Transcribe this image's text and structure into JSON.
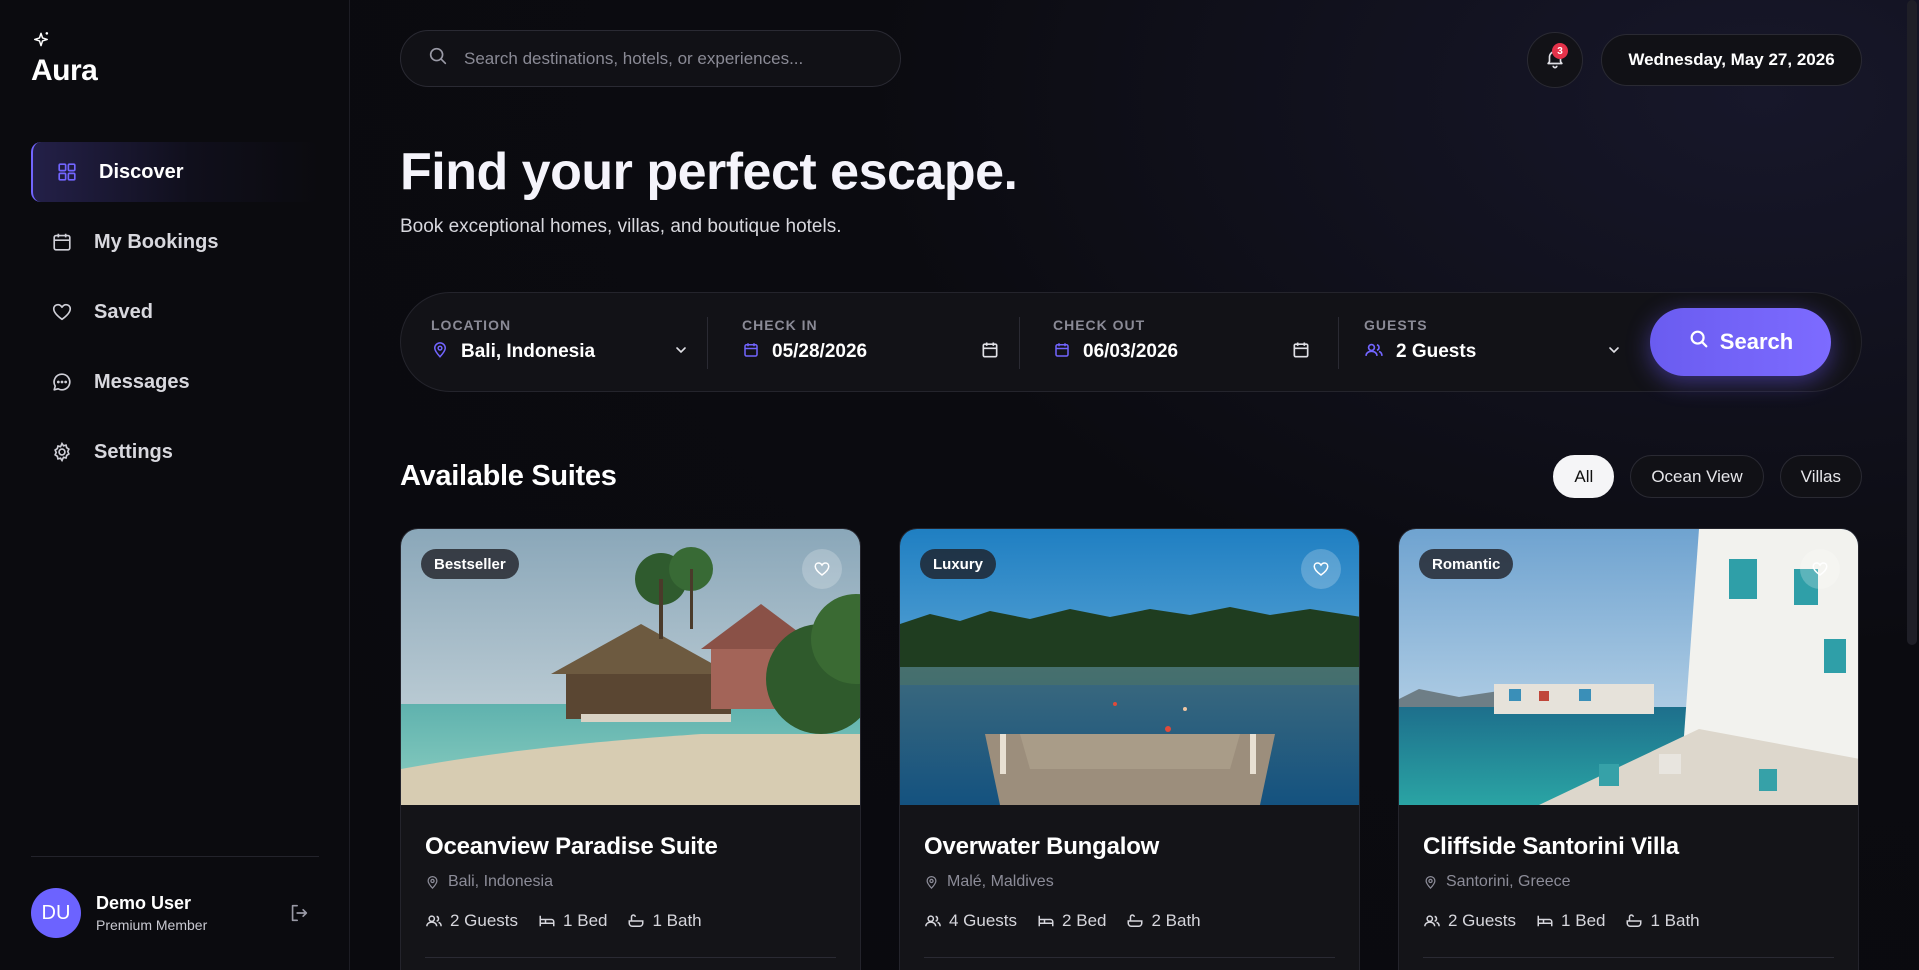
{
  "brand": {
    "name": "Aura",
    "icon": "sparkle-icon"
  },
  "sidebar": {
    "items": [
      {
        "label": "Discover",
        "icon": "grid-icon",
        "active": true
      },
      {
        "label": "My Bookings",
        "icon": "calendar-icon",
        "active": false
      },
      {
        "label": "Saved",
        "icon": "heart-icon",
        "active": false
      },
      {
        "label": "Messages",
        "icon": "chat-icon",
        "active": false
      },
      {
        "label": "Settings",
        "icon": "gear-icon",
        "active": false
      }
    ],
    "user": {
      "initials": "DU",
      "name": "Demo User",
      "plan": "Premium Member"
    }
  },
  "header": {
    "search_placeholder": "Search destinations, hotels, or experiences...",
    "notification_count": "3",
    "date": "Wednesday, May 27, 2026"
  },
  "hero": {
    "title": "Find your perfect escape.",
    "subtitle": "Book exceptional homes, villas, and boutique hotels."
  },
  "booking": {
    "location": {
      "label": "LOCATION",
      "value": "Bali, Indonesia"
    },
    "check_in": {
      "label": "CHECK IN",
      "value": "05/28/2026"
    },
    "check_out": {
      "label": "CHECK OUT",
      "value": "06/03/2026"
    },
    "guests": {
      "label": "GUESTS",
      "value": "2 Guests"
    },
    "search_label": "Search"
  },
  "suites": {
    "title": "Available Suites",
    "filters": [
      {
        "label": "All",
        "active": true
      },
      {
        "label": "Ocean View",
        "active": false
      },
      {
        "label": "Villas",
        "active": false
      }
    ],
    "cards": [
      {
        "tag": "Bestseller",
        "title": "Oceanview Paradise Suite",
        "location": "Bali, Indonesia",
        "guests": "2 Guests",
        "beds": "1 Bed",
        "baths": "1 Bath"
      },
      {
        "tag": "Luxury",
        "title": "Overwater Bungalow",
        "location": "Malé, Maldives",
        "guests": "4 Guests",
        "beds": "2 Bed",
        "baths": "2 Bath"
      },
      {
        "tag": "Romantic",
        "title": "Cliffside Santorini Villa",
        "location": "Santorini, Greece",
        "guests": "2 Guests",
        "beds": "1 Bed",
        "baths": "1 Bath"
      }
    ]
  },
  "colors": {
    "accent": "#6c63ff",
    "badge": "#e5324a",
    "background": "#0a0a0e"
  }
}
